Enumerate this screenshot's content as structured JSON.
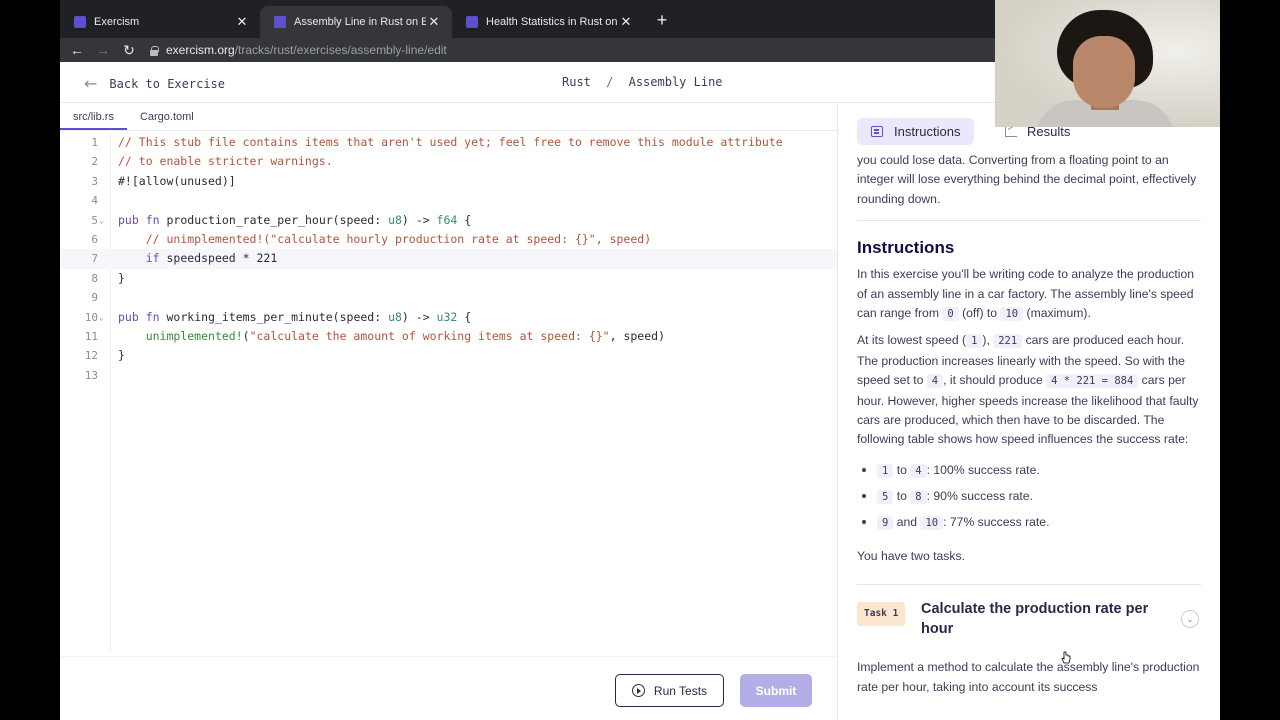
{
  "browser": {
    "tabs": [
      {
        "title": "Exercism",
        "active": false
      },
      {
        "title": "Assembly Line in Rust on Exercism",
        "active": true
      },
      {
        "title": "Health Statistics in Rust on Exercism",
        "active": false
      }
    ],
    "url_host": "exercism.org",
    "url_path": "/tracks/rust/exercises/assembly-line/edit"
  },
  "header": {
    "back_label": "Back to Exercise",
    "track": "Rust",
    "separator": "/",
    "exercise": "Assembly Line"
  },
  "editor": {
    "files": [
      "src/lib.rs",
      "Cargo.toml"
    ],
    "current_line": 7,
    "lines": [
      "// This stub file contains items that aren't used yet; feel free to remove this module attribute",
      "// to enable stricter warnings.",
      "#![allow(unused)]",
      "",
      "pub fn production_rate_per_hour(speed: u8) -> f64 {",
      "    // unimplemented!(\"calculate hourly production rate at speed: {}\", speed)",
      "    if speedspeed * 221",
      "}",
      "",
      "pub fn working_items_per_minute(speed: u8) -> u32 {",
      "    unimplemented!(\"calculate the amount of working items at speed: {}\", speed)",
      "}",
      ""
    ],
    "run_label": "Run Tests",
    "submit_label": "Submit"
  },
  "panel": {
    "tab_instructions": "Instructions",
    "tab_results": "Results",
    "intro_fragment": "you could lose data. Converting from a floating point to an integer will lose everything behind the decimal point, effectively rounding down.",
    "heading": "Instructions",
    "p1_a": "In this exercise you'll be writing code to analyze the production of an assembly line in a car factory. The assembly line's speed can range from ",
    "p1_code1": "0",
    "p1_b": " (off) to ",
    "p1_code2": "10",
    "p1_c": " (maximum).",
    "p2_a": "At its lowest speed (",
    "p2_code1": "1",
    "p2_b": "), ",
    "p2_code2": "221",
    "p2_c": " cars are produced each hour. The production increases linearly with the speed. So with the speed set to ",
    "p2_code3": "4",
    "p2_d": ", it should produce ",
    "p2_code4": "4 * 221 = 884",
    "p2_e": " cars per hour. However, higher speeds increase the likelihood that faulty cars are produced, which then have to be discarded. The following table shows how speed influences the success rate:",
    "rates": [
      {
        "from": "1",
        "conj": "to",
        "to": "4",
        "rate": ": 100% success rate."
      },
      {
        "from": "5",
        "conj": "to",
        "to": "8",
        "rate": ": 90% success rate."
      },
      {
        "from": "9",
        "conj": "and",
        "to": "10",
        "rate": ": 77% success rate."
      }
    ],
    "tasks_note": "You have two tasks.",
    "task_badge": "Task 1",
    "task_title": "Calculate the production rate per hour",
    "task_text": "Implement a method to calculate the assembly line's production rate per hour, taking into account its success"
  }
}
